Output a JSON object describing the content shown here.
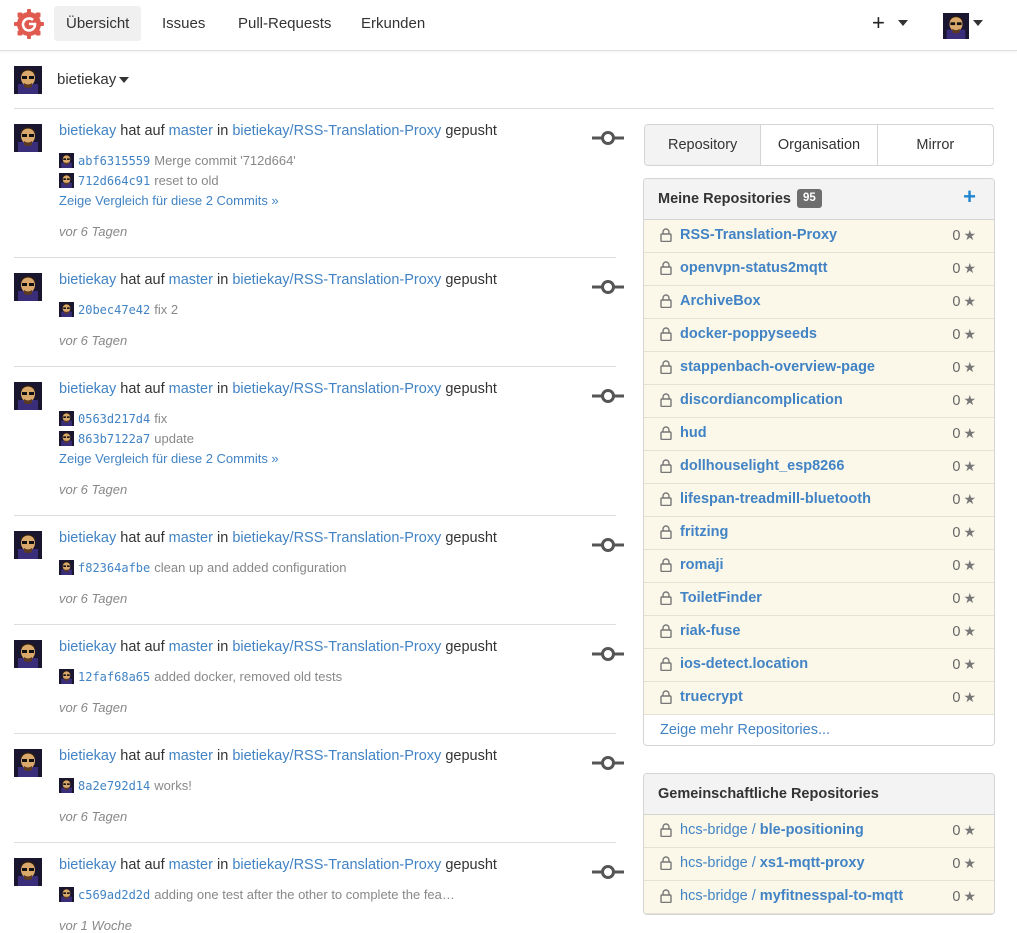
{
  "nav": {
    "items": [
      {
        "label": "Übersicht",
        "active": true
      },
      {
        "label": "Issues",
        "active": false
      },
      {
        "label": "Pull-Requests",
        "active": false
      },
      {
        "label": "Erkunden",
        "active": false
      }
    ],
    "plus": "+"
  },
  "user": {
    "name": "bietiekay"
  },
  "feed": [
    {
      "user": "bietiekay",
      "action": "hat auf",
      "branch": "master",
      "in": "in",
      "repo": "bietiekay/RSS-Translation-Proxy",
      "verb": "gepusht",
      "commits": [
        {
          "sha": "abf6315559",
          "msg": "Merge commit '712d664'"
        },
        {
          "sha": "712d664c91",
          "msg": "reset to old"
        }
      ],
      "compare": "Zeige Vergleich für diese 2 Commits »",
      "time": "vor 6 Tagen"
    },
    {
      "user": "bietiekay",
      "action": "hat auf",
      "branch": "master",
      "in": "in",
      "repo": "bietiekay/RSS-Translation-Proxy",
      "verb": "gepusht",
      "commits": [
        {
          "sha": "20bec47e42",
          "msg": "fix 2"
        }
      ],
      "compare": "",
      "time": "vor 6 Tagen"
    },
    {
      "user": "bietiekay",
      "action": "hat auf",
      "branch": "master",
      "in": "in",
      "repo": "bietiekay/RSS-Translation-Proxy",
      "verb": "gepusht",
      "commits": [
        {
          "sha": "0563d217d4",
          "msg": "fix"
        },
        {
          "sha": "863b7122a7",
          "msg": "update"
        }
      ],
      "compare": "Zeige Vergleich für diese 2 Commits »",
      "time": "vor 6 Tagen"
    },
    {
      "user": "bietiekay",
      "action": "hat auf",
      "branch": "master",
      "in": "in",
      "repo": "bietiekay/RSS-Translation-Proxy",
      "verb": "gepusht",
      "commits": [
        {
          "sha": "f82364afbe",
          "msg": "clean up and added configuration"
        }
      ],
      "compare": "",
      "time": "vor 6 Tagen"
    },
    {
      "user": "bietiekay",
      "action": "hat auf",
      "branch": "master",
      "in": "in",
      "repo": "bietiekay/RSS-Translation-Proxy",
      "verb": "gepusht",
      "commits": [
        {
          "sha": "12faf68a65",
          "msg": "added docker, removed old tests"
        }
      ],
      "compare": "",
      "time": "vor 6 Tagen"
    },
    {
      "user": "bietiekay",
      "action": "hat auf",
      "branch": "master",
      "in": "in",
      "repo": "bietiekay/RSS-Translation-Proxy",
      "verb": "gepusht",
      "commits": [
        {
          "sha": "8a2e792d14",
          "msg": "works!"
        }
      ],
      "compare": "",
      "time": "vor 6 Tagen"
    },
    {
      "user": "bietiekay",
      "action": "hat auf",
      "branch": "master",
      "in": "in",
      "repo": "bietiekay/RSS-Translation-Proxy",
      "verb": "gepusht",
      "commits": [
        {
          "sha": "c569ad2d2d",
          "msg": "adding one test after the other to complete the fea…"
        }
      ],
      "compare": "",
      "time": "vor 1 Woche"
    }
  ],
  "repo_tabs": [
    {
      "label": "Repository",
      "active": true
    },
    {
      "label": "Organisation",
      "active": false
    },
    {
      "label": "Mirror",
      "active": false
    }
  ],
  "my_repos": {
    "title": "Meine Repositories",
    "count": "95",
    "add": "+",
    "items": [
      {
        "name": "RSS-Translation-Proxy",
        "stars": "0"
      },
      {
        "name": "openvpn-status2mqtt",
        "stars": "0"
      },
      {
        "name": "ArchiveBox",
        "stars": "0"
      },
      {
        "name": "docker-poppyseeds",
        "stars": "0"
      },
      {
        "name": "stappenbach-overview-page",
        "stars": "0"
      },
      {
        "name": "discordiancomplication",
        "stars": "0"
      },
      {
        "name": "hud",
        "stars": "0"
      },
      {
        "name": "dollhouselight_esp8266",
        "stars": "0"
      },
      {
        "name": "lifespan-treadmill-bluetooth",
        "stars": "0"
      },
      {
        "name": "fritzing",
        "stars": "0"
      },
      {
        "name": "romaji",
        "stars": "0"
      },
      {
        "name": "ToiletFinder",
        "stars": "0"
      },
      {
        "name": "riak-fuse",
        "stars": "0"
      },
      {
        "name": "ios-detect.location",
        "stars": "0"
      },
      {
        "name": "truecrypt",
        "stars": "0"
      }
    ],
    "more": "Zeige mehr Repositories..."
  },
  "shared_repos": {
    "title": "Gemeinschaftliche Repositories",
    "items": [
      {
        "owner": "hcs-bridge / ",
        "name": "ble-positioning",
        "stars": "0"
      },
      {
        "owner": "hcs-bridge / ",
        "name": "xs1-mqtt-proxy",
        "stars": "0"
      },
      {
        "owner": "hcs-bridge / ",
        "name": "myfitnesspal-to-mqtt",
        "stars": "0"
      }
    ]
  },
  "colors": {
    "accent": "#4183c4",
    "brand": "#e05a4f",
    "repo_bg": "#fbf8ea",
    "badge": "#6e6e6e"
  }
}
